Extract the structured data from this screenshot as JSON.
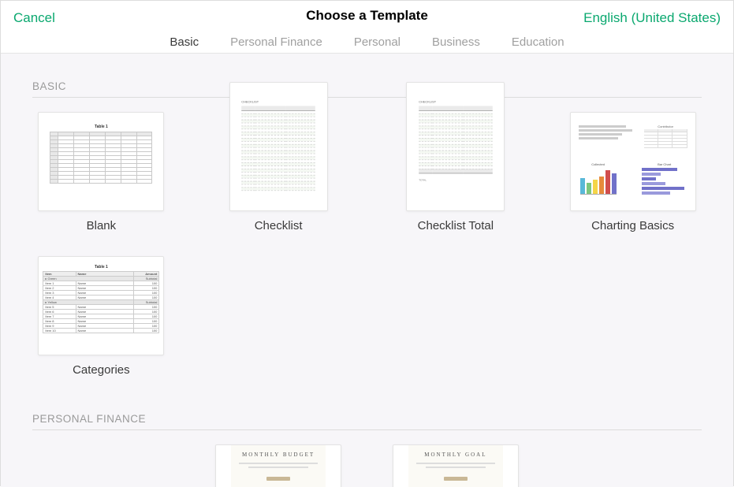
{
  "header": {
    "cancel": "Cancel",
    "title": "Choose a Template",
    "language": "English (United States)"
  },
  "tabs": {
    "basic": "Basic",
    "personal_finance": "Personal Finance",
    "personal": "Personal",
    "business": "Business",
    "education": "Education"
  },
  "sections": {
    "basic": {
      "heading": "BASIC",
      "templates": {
        "blank": "Blank",
        "checklist": "Checklist",
        "checklist_total": "Checklist Total",
        "charting_basics": "Charting Basics",
        "categories": "Categories"
      }
    },
    "personal_finance": {
      "heading": "PERSONAL FINANCE",
      "templates": {
        "monthly_budget_thumb_title": "MONTHLY BUDGET",
        "monthly_goal_thumb_title": "MONTHLY GOAL"
      }
    }
  }
}
